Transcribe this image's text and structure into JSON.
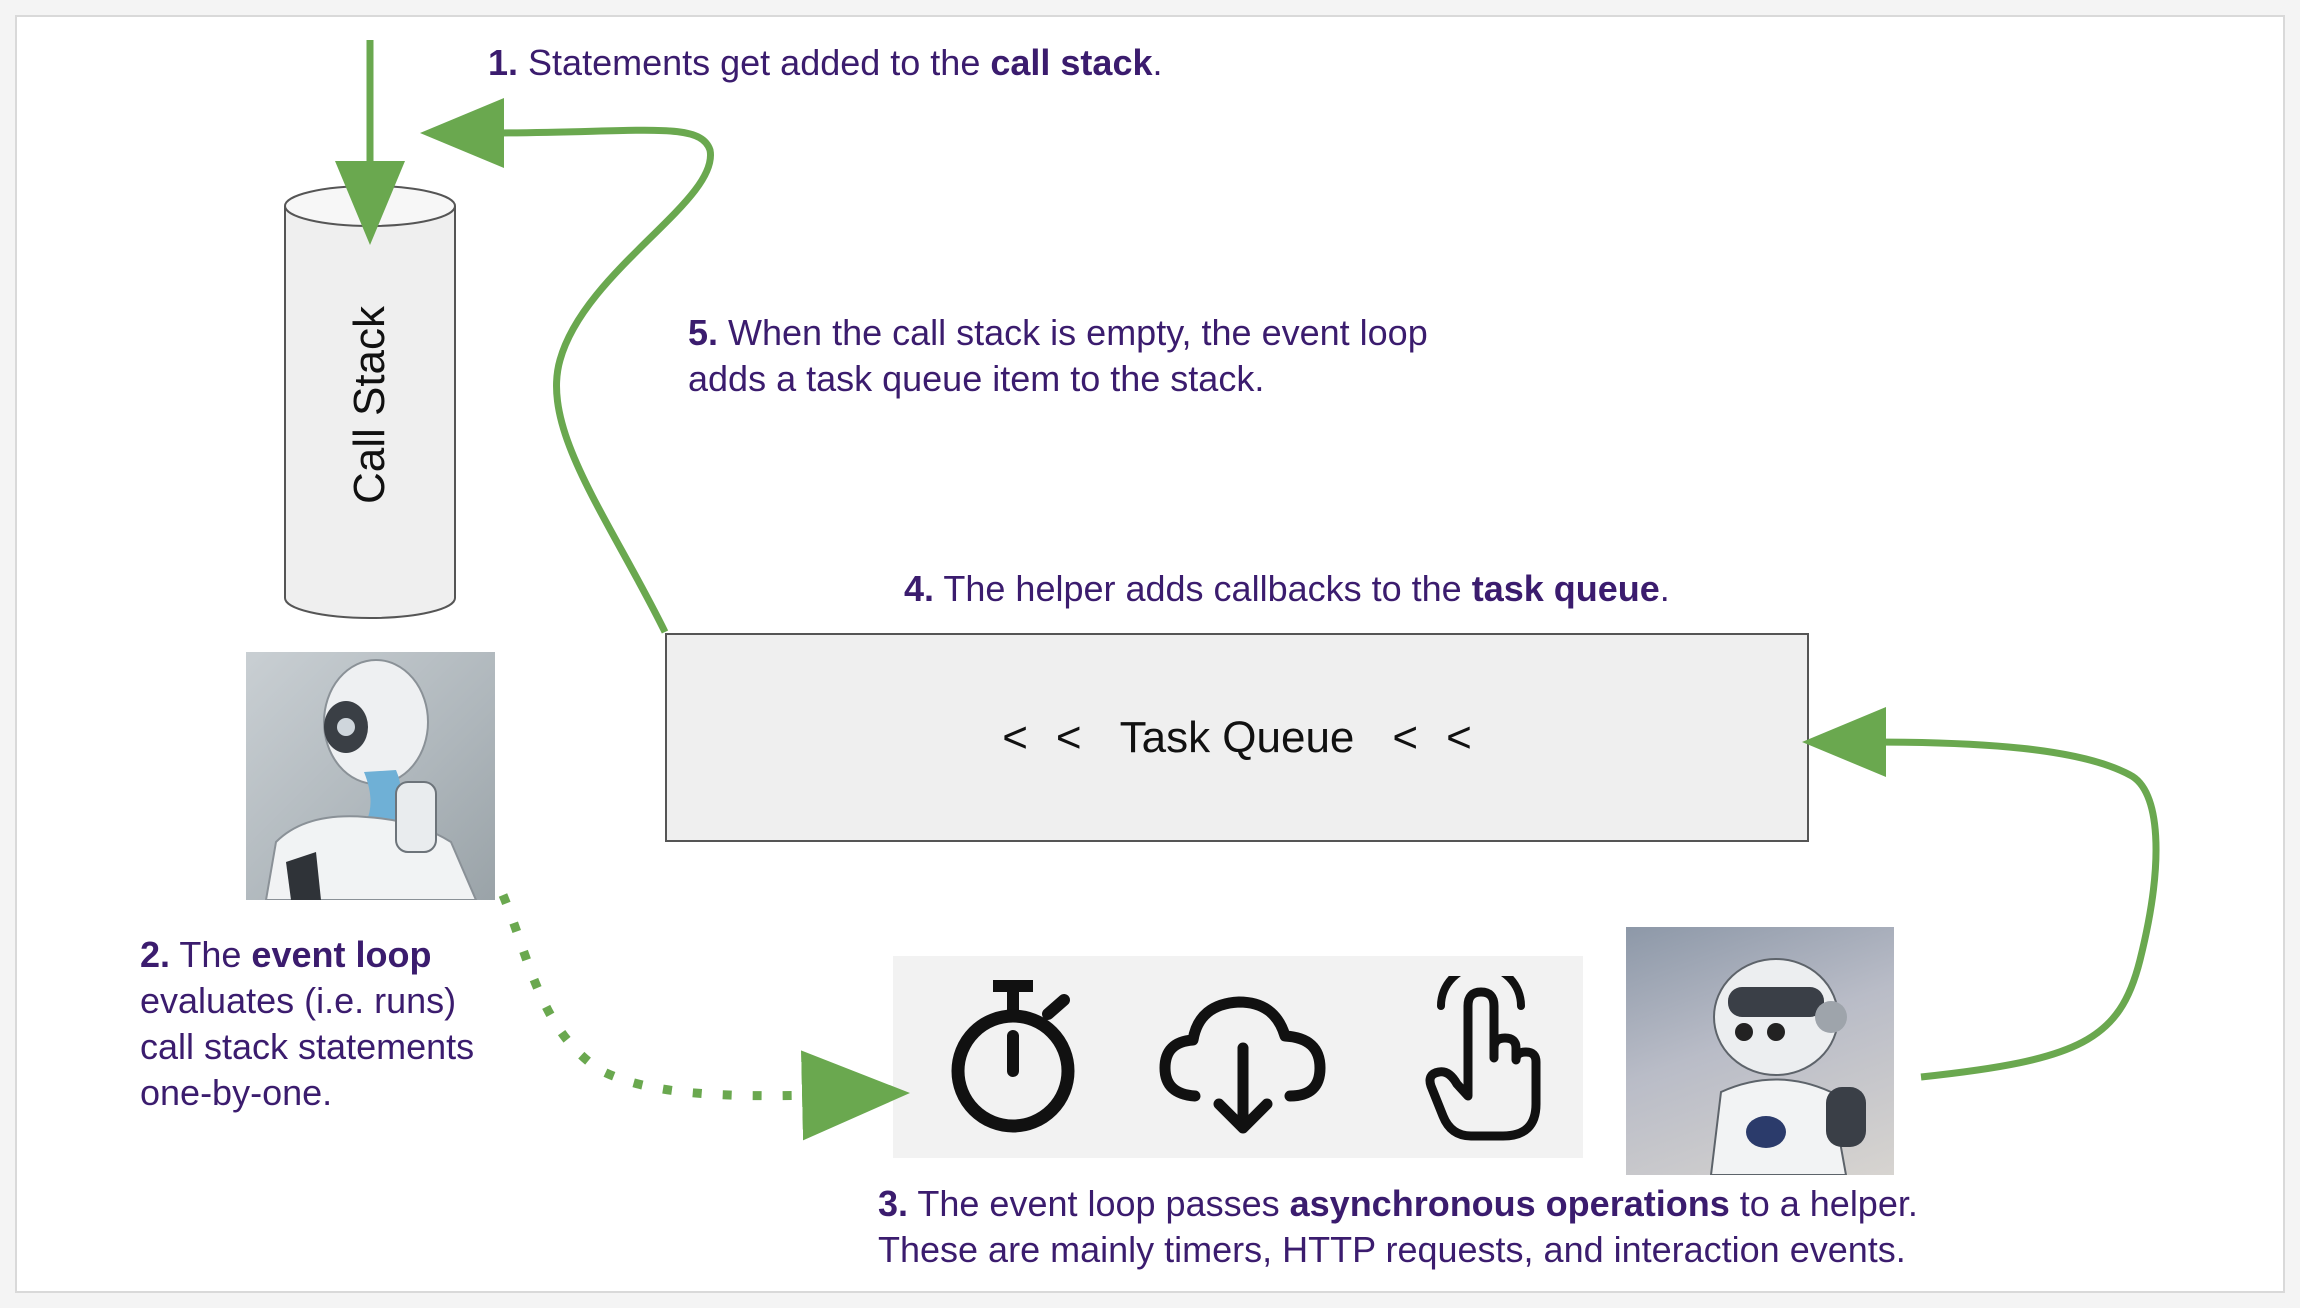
{
  "steps": {
    "s1": {
      "num": "1.",
      "pre": " Statements get added to the ",
      "bold": "call stack",
      "post": "."
    },
    "s2": {
      "num": "2.",
      "pre": " The ",
      "bold": "event loop",
      "line2": "evaluates (i.e. runs)",
      "line3": "call stack statements",
      "line4": "one-by-one."
    },
    "s3": {
      "num": "3.",
      "pre": " The event loop passes ",
      "bold": "asynchronous operations",
      "post": " to a helper.",
      "line2": "These are mainly timers, HTTP requests, and interaction events."
    },
    "s4": {
      "num": "4.",
      "pre": " The helper adds callbacks to the ",
      "bold": "task queue",
      "post": "."
    },
    "s5": {
      "num": "5.",
      "pre": " When the call stack is empty, the event loop",
      "line2": "adds a task queue item to the stack."
    }
  },
  "call_stack": {
    "label": "Call Stack"
  },
  "task_queue": {
    "chevron": "<",
    "label": "Task Queue"
  },
  "icons": [
    "stopwatch-icon",
    "cloud-download-icon",
    "pointing-hand-icon"
  ],
  "images": [
    "thinking-robot",
    "helper-robot"
  ],
  "colors": {
    "arrow": "#6aa84f",
    "caption_text": "#3b1c6e",
    "queue_fill": "#efefef"
  }
}
